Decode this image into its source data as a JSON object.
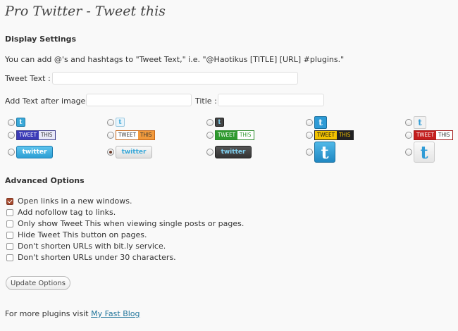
{
  "title": "Pro Twitter - Tweet this",
  "display_settings": {
    "heading": "Display Settings",
    "help_text": "You can add @'s and hashtags to \"Tweet Text,\" i.e. \"@Haotikus [TITLE] [URL] #plugins.\"",
    "tweet_text_label": "Tweet Text :",
    "tweet_text_value": "",
    "add_text_label": "Add Text after image :",
    "add_text_value": "",
    "title_label": "Title :",
    "title_value": ""
  },
  "button_styles": {
    "selected": "twitter-logo-gray",
    "row2": [
      {
        "a": "TWEET",
        "b": "THIS"
      },
      {
        "a": "TWEET",
        "b": "THIS"
      },
      {
        "a": "TWEET",
        "b": "THIS"
      },
      {
        "a": "TWEET",
        "b": "THIS"
      },
      {
        "a": "TWEET",
        "b": "THIS"
      }
    ],
    "logo_text": "twitter",
    "bird_glyph": "t"
  },
  "advanced": {
    "heading": "Advanced Options",
    "options": [
      {
        "label": "Open links in a new windows.",
        "checked": true
      },
      {
        "label": "Add nofollow tag to links.",
        "checked": false
      },
      {
        "label": "Only show Tweet This when viewing single posts or pages.",
        "checked": false
      },
      {
        "label": "Hide Tweet This button on pages.",
        "checked": false
      },
      {
        "label": "Don't shorten URLs with bit.ly service.",
        "checked": false
      },
      {
        "label": "Don't shorten URLs under 30 characters.",
        "checked": false
      }
    ],
    "submit_label": "Update Options"
  },
  "footer": {
    "text": "For more plugins visit",
    "link_text": "My Fast Blog"
  },
  "colors": {
    "link": "#21759b",
    "checkbox_checked": "#a64a2e"
  }
}
